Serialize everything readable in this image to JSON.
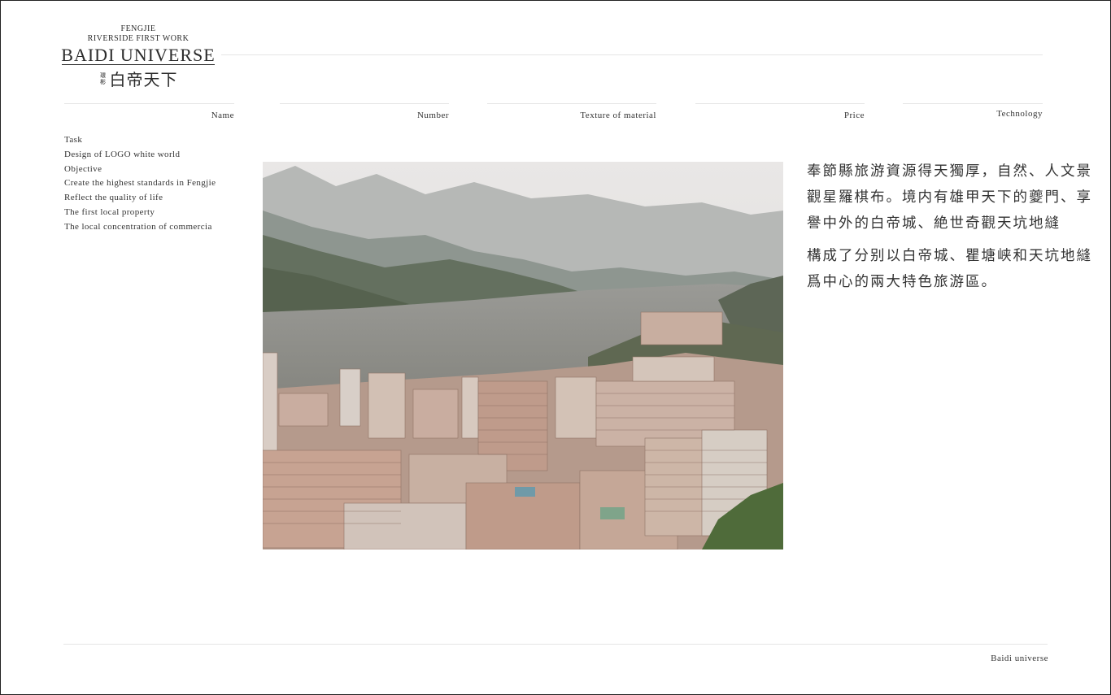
{
  "logo": {
    "line1": "FENGJIE",
    "line2": "RIVERSIDE FIRST WORK",
    "line3": "BAIDI UNIVERSE",
    "small_cn_1": "環",
    "small_cn_2": "彬",
    "chinese": "白帝天下"
  },
  "header": {
    "columns": [
      "Name",
      "Number",
      "Texture of material",
      "Price",
      "Technology"
    ]
  },
  "left_list": [
    "Task",
    "Design of LOGO white world",
    "Objective",
    "Create the highest standards in Fengjie",
    "Reflect the quality of life",
    "The first local property",
    "The local concentration of commercia"
  ],
  "body": {
    "paragraph1": "奉節縣旅游資源得天獨厚，自然、人文景觀星羅棋布。境内有雄甲天下的夔門、享譽中外的白帝城、絶世奇觀天坑地縫",
    "paragraph2": "構成了分别以白帝城、瞿塘峡和天坑地縫爲中心的兩大特色旅游區。"
  },
  "footer": {
    "label": "Baidi universe"
  },
  "colors": {
    "text": "#333333",
    "rule": "#e6e6e6",
    "border": "#222222"
  }
}
